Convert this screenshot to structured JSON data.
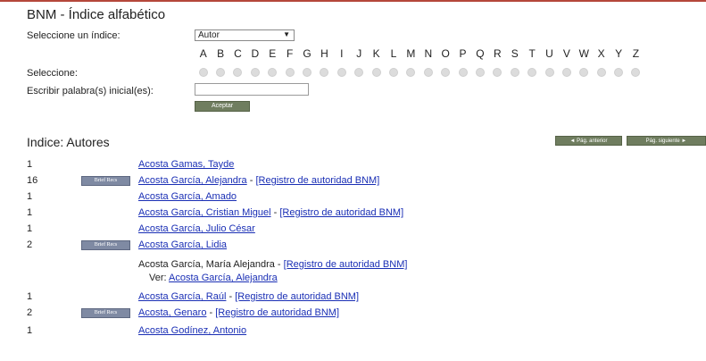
{
  "page": {
    "title": "BNM - Índice alfabético",
    "select_index_label": "Seleccione un índice:",
    "select_value": "Autor",
    "select_label": "Seleccione:",
    "initial_words_label": "Escribir palabra(s) inicial(es):",
    "initial_words_value": "",
    "accept_label": "Aceptar",
    "letters": [
      "A",
      "B",
      "C",
      "D",
      "E",
      "F",
      "G",
      "H",
      "I",
      "J",
      "K",
      "L",
      "M",
      "N",
      "O",
      "P",
      "Q",
      "R",
      "S",
      "T",
      "U",
      "V",
      "W",
      "X",
      "Y",
      "Z"
    ]
  },
  "results": {
    "title": "Indice: Autores",
    "prev_label": "◄ Pág. anterior",
    "next_label": "Pág. siguiente ►",
    "brief_label": "Brief Recs",
    "authority_label": "[Registro de autoridad BNM]",
    "see_label": "Ver:",
    "rows": [
      {
        "count": "1",
        "name": "Acosta Gamas, Tayde"
      },
      {
        "count": "16",
        "name": "Acosta García, Alejandra"
      },
      {
        "count": "1",
        "name": "Acosta García, Amado"
      },
      {
        "count": "1",
        "name": "Acosta García, Cristian Miguel"
      },
      {
        "count": "1",
        "name": "Acosta García, Julio César"
      },
      {
        "count": "2",
        "name": "Acosta García, Lidia"
      },
      {
        "count": "",
        "name": "Acosta García, María Alejandra",
        "see": "Acosta García, Alejandra"
      },
      {
        "count": "1",
        "name": "Acosta García, Raúl"
      },
      {
        "count": "2",
        "name": "Acosta, Genaro"
      },
      {
        "count": "1",
        "name": "Acosta Godínez, Antonio"
      }
    ]
  }
}
